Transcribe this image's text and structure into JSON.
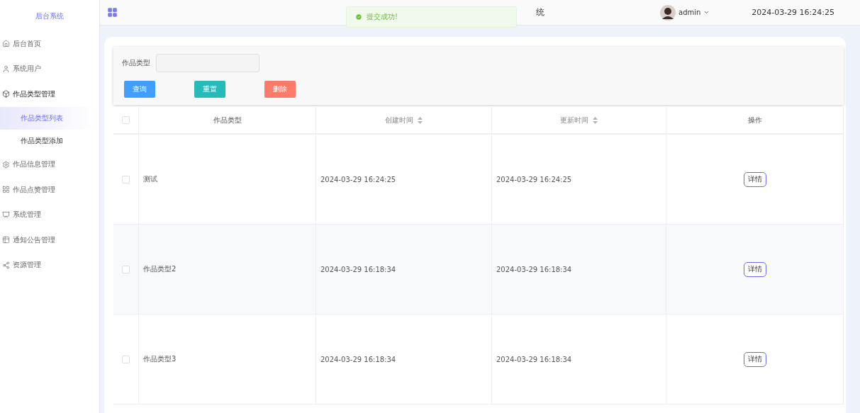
{
  "sidebar": {
    "title": "后台系统",
    "items": [
      {
        "label": "后台首页",
        "expanded": false
      },
      {
        "label": "系统用户",
        "expanded": false
      },
      {
        "label": "作品类型管理",
        "expanded": true,
        "children": [
          {
            "label": "作品类型列表",
            "selected": true
          },
          {
            "label": "作品类型添加",
            "selected": false
          }
        ]
      },
      {
        "label": "作品信息管理",
        "expanded": false
      },
      {
        "label": "作品点赞管理",
        "expanded": false
      },
      {
        "label": "系统管理",
        "expanded": false
      },
      {
        "label": "通知公告管理",
        "expanded": false
      },
      {
        "label": "资源管理",
        "expanded": false
      }
    ]
  },
  "header": {
    "title": "统",
    "user": "admin",
    "datetime": "2024-03-29 16:24:25"
  },
  "toast": {
    "message": "提交成功!"
  },
  "search": {
    "label": "作品类型",
    "buttons": [
      {
        "label": "查询",
        "kind": "primary"
      },
      {
        "label": "重置",
        "kind": "reset"
      },
      {
        "label": "删除",
        "kind": "danger"
      }
    ]
  },
  "table": {
    "all_checked": false,
    "columns": [
      {
        "label": "作品类型",
        "sortable": false
      },
      {
        "label": "创建时间",
        "sortable": true
      },
      {
        "label": "更新时间",
        "sortable": true
      },
      {
        "label": "操作",
        "sortable": false
      }
    ],
    "rows": [
      {
        "type": "测试",
        "created": "2024-03-29 16:24:25",
        "updated": "2024-03-29 16:24:25",
        "action": "详情",
        "checked": false
      },
      {
        "type": "作品类型2",
        "created": "2024-03-29 16:18:34",
        "updated": "2024-03-29 16:18:34",
        "action": "详情",
        "checked": false
      },
      {
        "type": "作品类型3",
        "created": "2024-03-29 16:18:34",
        "updated": "2024-03-29 16:18:34",
        "action": "详情",
        "checked": false
      }
    ]
  }
}
